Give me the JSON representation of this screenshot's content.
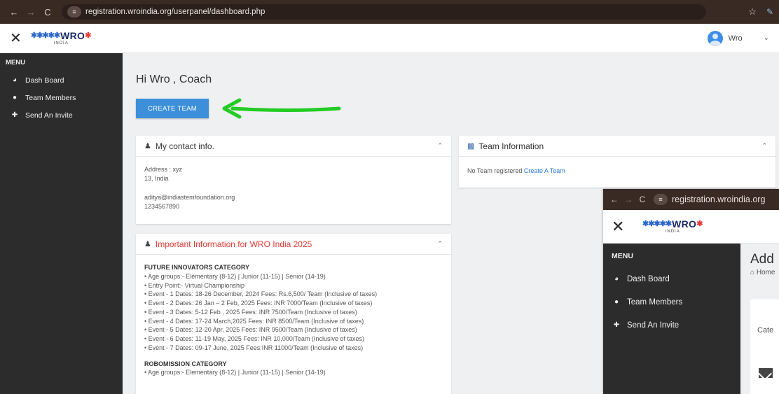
{
  "browser": {
    "back_icon": "←",
    "forward_icon": "→",
    "reload_icon": "C",
    "url": "registration.wroindia.org/userpanel/dashboard.php",
    "site_settings_icon": "≡",
    "star_icon": "☆",
    "extension_icon": "✎"
  },
  "header": {
    "close_icon": "✕",
    "logo_figures": "✱✱✱✱✱",
    "logo_text": "WRO",
    "logo_sub": "INDIA",
    "user_name": "Wro",
    "user_menu_icon": "⌄"
  },
  "sidebar": {
    "menu_title": "MENU",
    "items": [
      {
        "icon": "◕",
        "label": "Dash Board"
      },
      {
        "icon": "●",
        "label": "Team Members"
      },
      {
        "icon": "✚",
        "label": "Send An Invite"
      }
    ]
  },
  "main": {
    "greeting": "Hi Wro , Coach",
    "create_team_label": "CREATE TEAM",
    "contact": {
      "title": "My contact info.",
      "address_line1": "Address : xyz",
      "address_line2": "13, India",
      "email": "aditya@indiastemfoundation.org",
      "phone": "1234567890"
    },
    "team_info": {
      "title": "Team Information",
      "empty_text": "No Team registered ",
      "create_link": "Create A Team"
    },
    "important": {
      "title": "Important Information for WRO India 2025",
      "fi_heading": "FUTURE INNOVATORS CATEGORY",
      "fi_lines": [
        "• Age groups:- Elementary (8-12) | Junior (11-15) | Senior (14-19)",
        "• Entry Point:- Virtual Championship",
        "• Event - 1 Dates: 18-26 December, 2024 Fees: Rs.6,500/ Team (Inclusive of taxes)",
        "• Event - 2 Dates: 26 Jan – 2 Feb, 2025 Fees: INR 7000/Team (Inclusive of taxes)",
        "• Event - 3 Dates: 5-12 Feb , 2025 Fees: INR 7500/Team (Inclusive of taxes)",
        "• Event - 4 Dates: 17-24 March,2025 Fees: INR 8500/Team (Inclusive of taxes)",
        "• Event - 5 Dates: 12-20 Apr, 2025 Fees: INR 9500/Team (Inclusive of taxes)",
        "• Event - 6 Dates: 11-19 May, 2025 Fees: INR 10,000/Team (Inclusive of taxes)",
        "• Event - 7 Dates: 09-17 June, 2025 Fees:INR 11000/Team (Inclusive of taxes)"
      ],
      "rm_heading": "ROBOMISSION CATEGORY",
      "rm_lines": [
        "• Age groups:- Elementary (8-12) | Junior (11-15) | Senior (14-19)"
      ]
    }
  },
  "overlay": {
    "url": "registration.wroindia.org",
    "menu_title": "MENU",
    "items": [
      {
        "icon": "◕",
        "label": "Dash Board"
      },
      {
        "icon": "●",
        "label": "Team Members"
      },
      {
        "icon": "✚",
        "label": "Send An Invite"
      }
    ],
    "title": "Add",
    "breadcrumb": "⌂ Home",
    "category_label": "Cate"
  },
  "colors": {
    "accent": "#3d8fd9",
    "arrow": "#22cc22",
    "sidebar": "#2c2c2c",
    "important_title": "#e53935"
  }
}
